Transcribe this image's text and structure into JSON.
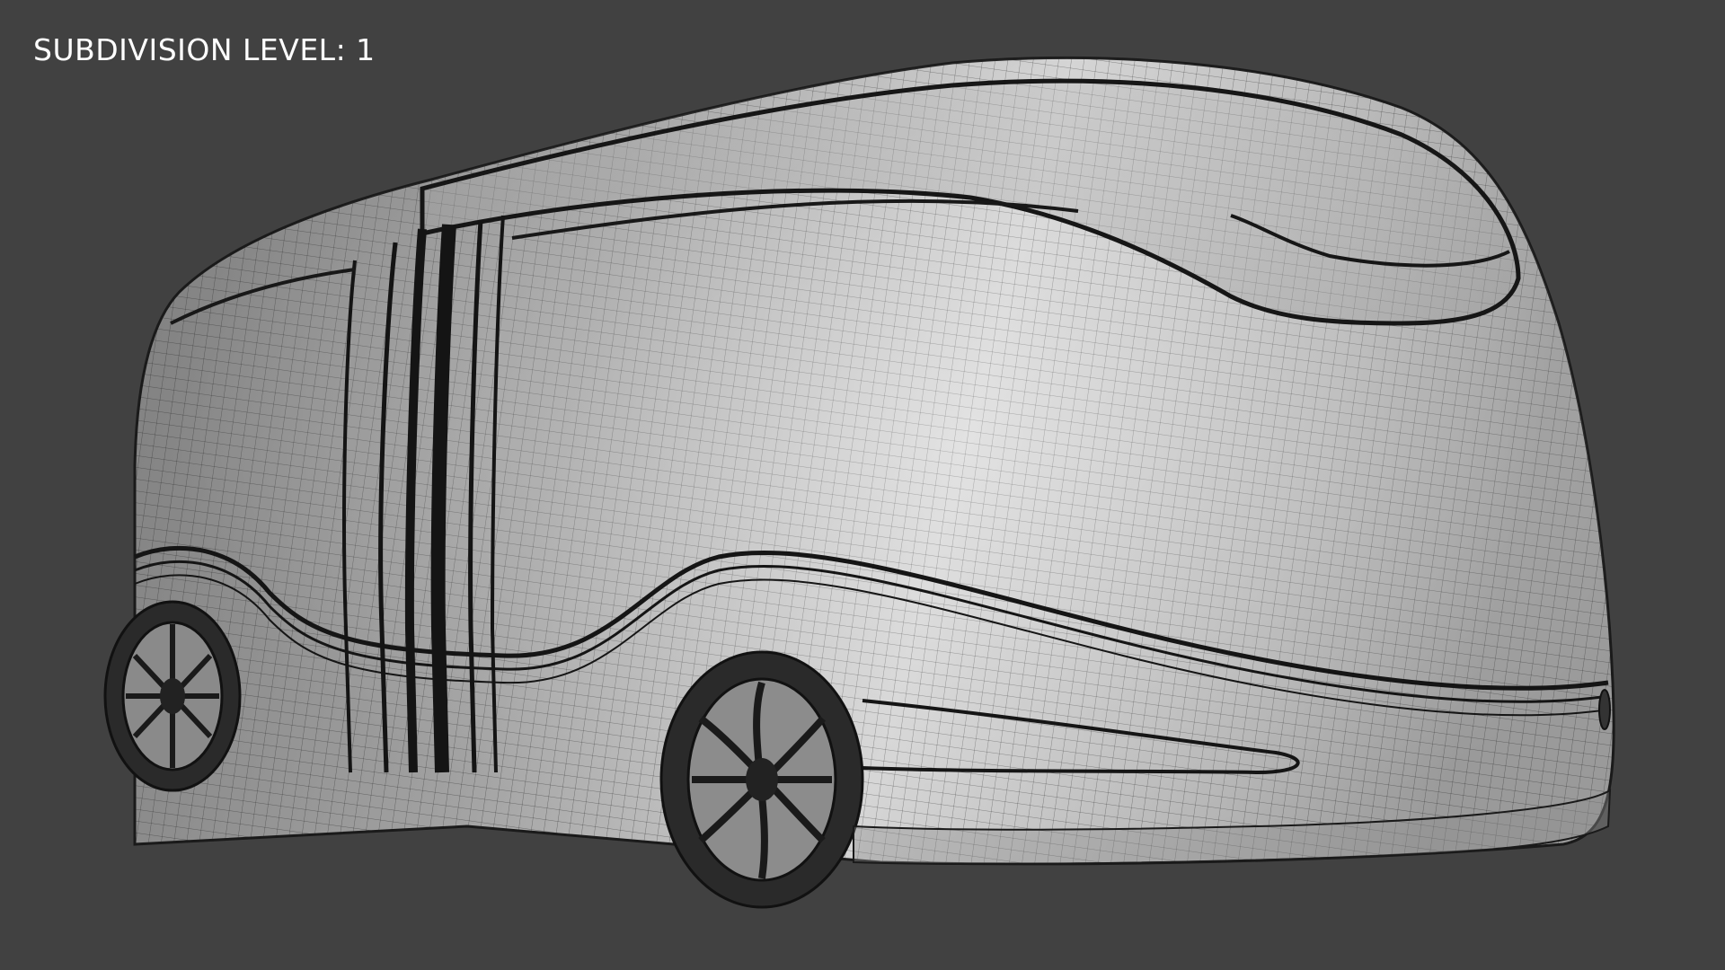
{
  "viewport": {
    "overlay_text": "SUBDIVISION LEVEL: 1",
    "background_color": "#414141",
    "model": {
      "subject": "bus",
      "display_mode": "shaded-wireframe"
    }
  }
}
